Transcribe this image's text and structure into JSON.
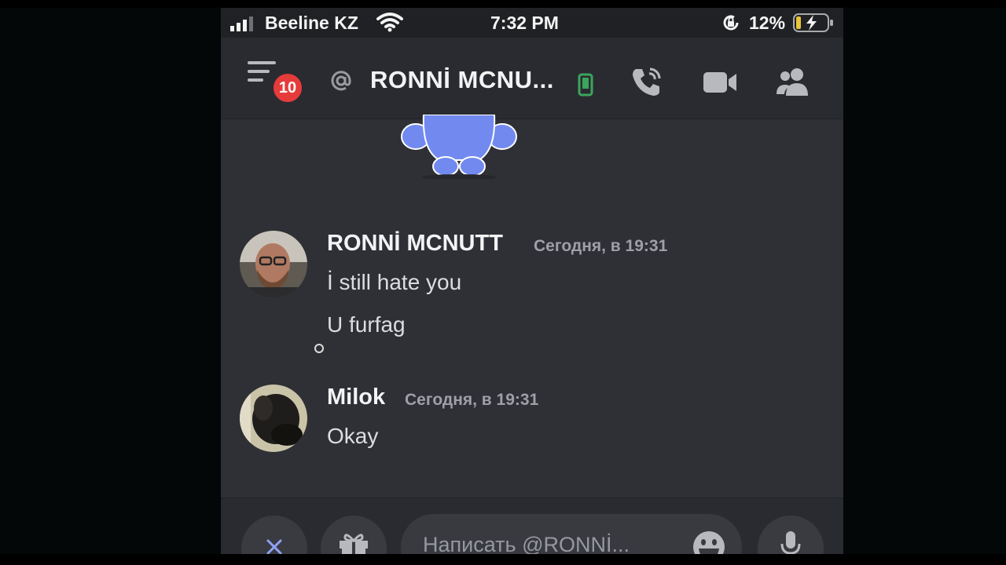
{
  "status_bar": {
    "carrier": "Beeline KZ",
    "time": "7:32 PM",
    "battery": "12%"
  },
  "header": {
    "notification_badge": "10",
    "dm_name": "RONNİ MCNU..."
  },
  "messages": [
    {
      "author": "RONNİ MCNUTT",
      "timestamp": "Сегодня, в 19:31",
      "lines": [
        "İ still hate you",
        "U furfag"
      ]
    },
    {
      "author": "Milok",
      "timestamp": "Сегодня, в 19:31",
      "lines": [
        "Okay"
      ]
    }
  ],
  "composer": {
    "placeholder": "Написать @RONNİ..."
  },
  "icons": [
    "signal-icon",
    "wifi-icon",
    "orientation-lock-icon",
    "battery-charging-icon",
    "menu-icon",
    "at-icon",
    "mobile-status-icon",
    "call-icon",
    "video-icon",
    "members-icon",
    "wumpus-mascot",
    "close-icon",
    "gift-icon",
    "emoji-icon",
    "mic-icon"
  ],
  "colors": {
    "background": "#2f3035",
    "badge": "#e63b3b",
    "online_mobile": "#3ba55c",
    "wumpus": "#7289f0"
  }
}
